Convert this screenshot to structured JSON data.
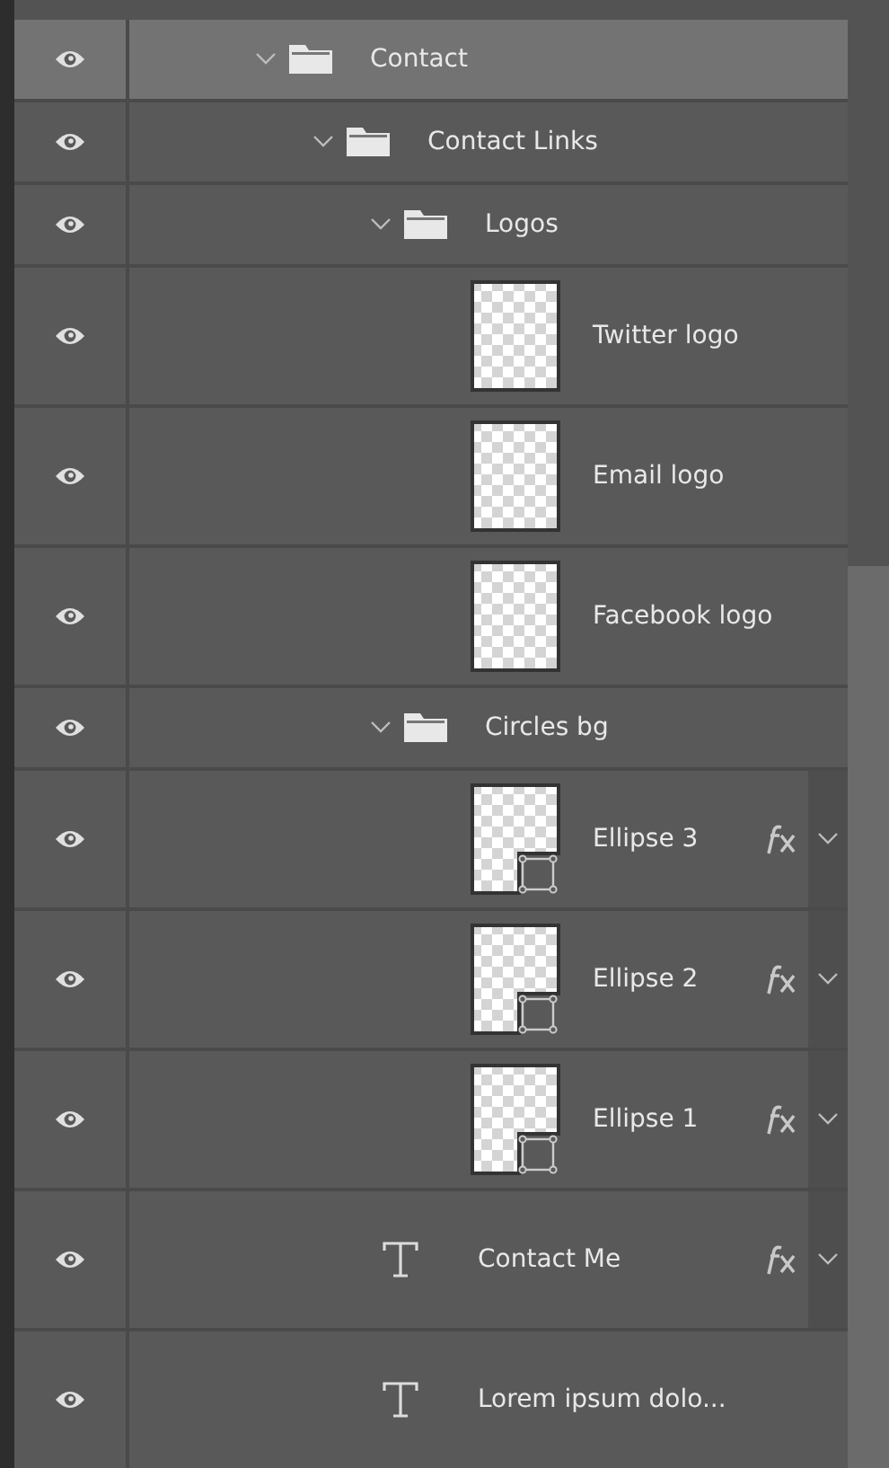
{
  "layers": [
    {
      "kind": "group",
      "name": "Contact",
      "visible": true,
      "selected": true,
      "expanded": true,
      "children": [
        {
          "kind": "group",
          "name": "Contact Links",
          "visible": true,
          "selected": false,
          "expanded": true,
          "children": [
            {
              "kind": "group",
              "name": "Logos",
              "visible": true,
              "selected": false,
              "expanded": true,
              "children": [
                {
                  "kind": "pixel",
                  "name": "Twitter logo",
                  "visible": true,
                  "selected": false,
                  "fx": false
                },
                {
                  "kind": "pixel",
                  "name": "Email logo",
                  "visible": true,
                  "selected": false,
                  "fx": false
                },
                {
                  "kind": "pixel",
                  "name": "Facebook logo",
                  "visible": true,
                  "selected": false,
                  "fx": false
                }
              ]
            },
            {
              "kind": "group",
              "name": "Circles bg",
              "visible": true,
              "selected": false,
              "expanded": true,
              "children": [
                {
                  "kind": "shape",
                  "name": "Ellipse 3",
                  "visible": true,
                  "selected": false,
                  "fx": true
                },
                {
                  "kind": "shape",
                  "name": "Ellipse 2",
                  "visible": true,
                  "selected": false,
                  "fx": true
                },
                {
                  "kind": "shape",
                  "name": "Ellipse 1",
                  "visible": true,
                  "selected": false,
                  "fx": true
                }
              ]
            }
          ]
        },
        {
          "kind": "text",
          "name": "Contact Me",
          "visible": true,
          "selected": false,
          "fx": true
        },
        {
          "kind": "text",
          "name": "Lorem ipsum dolo...",
          "visible": true,
          "selected": false,
          "fx": false
        }
      ]
    }
  ]
}
